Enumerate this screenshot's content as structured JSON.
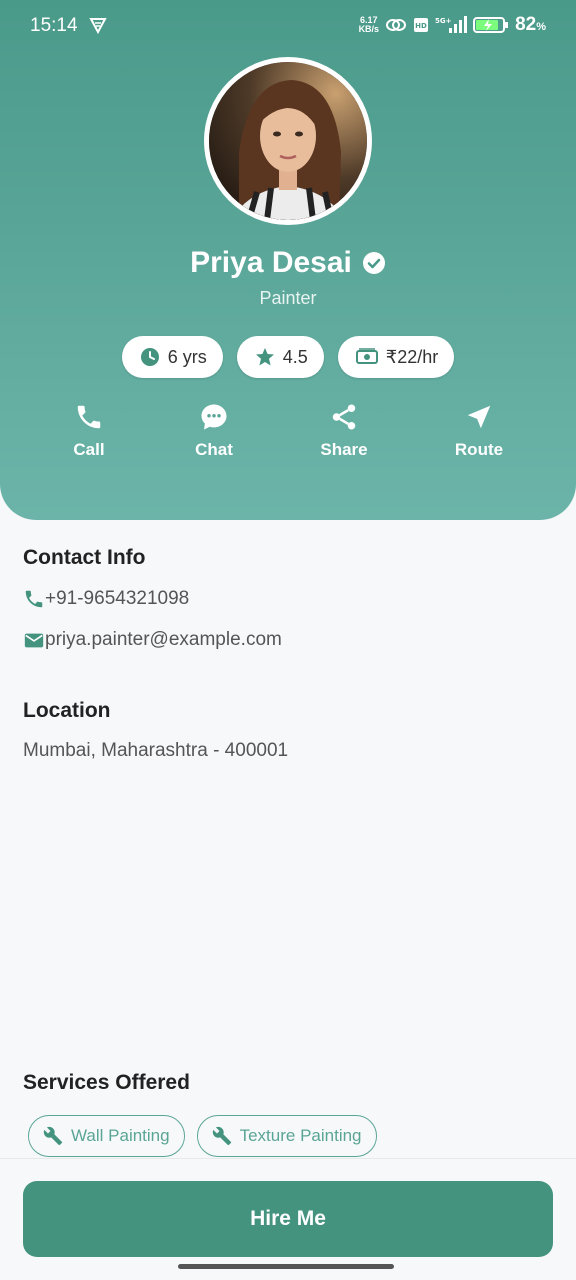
{
  "status_bar": {
    "time": "15:14",
    "net_speed": "6.17",
    "net_unit": "KB/s",
    "battery": "82",
    "battery_unit": "%"
  },
  "profile": {
    "name": "Priya Desai",
    "role": "Painter",
    "verified": true
  },
  "stats": [
    {
      "icon": "clock-icon",
      "label": "6 yrs"
    },
    {
      "icon": "star-icon",
      "label": "4.5"
    },
    {
      "icon": "cash-icon",
      "label": "₹22/hr"
    }
  ],
  "actions": [
    {
      "icon": "phone-icon",
      "label": "Call"
    },
    {
      "icon": "chat-icon",
      "label": "Chat"
    },
    {
      "icon": "share-icon",
      "label": "Share"
    },
    {
      "icon": "navigation-icon",
      "label": "Route"
    }
  ],
  "contact": {
    "title": "Contact Info",
    "phone": "+91-9654321098",
    "email": "priya.painter@example.com"
  },
  "location": {
    "title": "Location",
    "address": "Mumbai, Maharashtra - 400001"
  },
  "services": {
    "title": "Services Offered",
    "items": [
      "Wall Painting",
      "Texture Painting"
    ]
  },
  "hire_button": "Hire Me",
  "colors": {
    "accent": "#44937f",
    "header_top": "#4a9a8a",
    "header_bottom": "#6cb4a9"
  }
}
